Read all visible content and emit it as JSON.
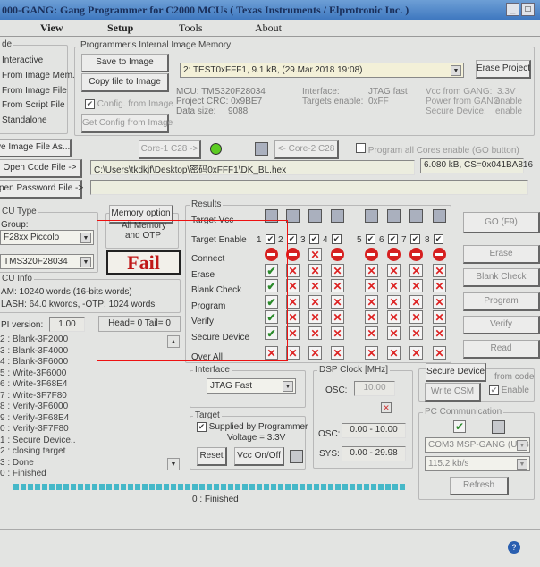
{
  "title": "000-GANG:  Gang Programmer for C2000  MCUs ( Texas Instruments / Elprotronic Inc. )",
  "menu": [
    "View",
    "Setup",
    "Tools",
    "About"
  ],
  "mode": {
    "legend": "de",
    "items": [
      "Interactive",
      "From Image Mem.",
      "From Image File",
      "From Script File",
      "Standalone"
    ]
  },
  "image_memory": {
    "legend": "Programmer's Internal Image Memory",
    "save": "Save to Image",
    "copy": "Copy file to Image",
    "config_from_image": "Config. from Image",
    "get_config": "Get Config from Image",
    "selected": "2: TEST0xFFF1,  9.1 kB,  (29.Mar.2018  19:08)",
    "erase_project": "Erase Project",
    "info": {
      "mcu": "MCU:  TMS320F28034",
      "crc": "Project CRC: 0x9BE7",
      "data_size_label": "Data size:",
      "data_size": "9088",
      "interface_label": "Interface:",
      "interface": "JTAG fast",
      "targets_label": "Targets enable:",
      "targets": "0xFF",
      "vcc_label": "Vcc from GANG:",
      "vcc": "3.3V",
      "power_label": "Power from GANG:",
      "power": "enable",
      "secure_label": "Secure Device:",
      "secure": "enable"
    }
  },
  "save_image_file": "ve Image File As...",
  "core1": "Core-1 C28 ->",
  "core2": "<- Core-2 C28",
  "program_all_cores": "Program all Cores enable (GO button)",
  "open_code": "Open Code File ->",
  "code_path": "C:\\Users\\tkdkjf\\Desktop\\密码0xFFF1\\DK_BL.hex",
  "code_info": "6.080 kB, CS=0x041BA816",
  "open_password": "pen Password File ->",
  "mcu_type": {
    "legend": "CU Type",
    "group_label": "Group:",
    "group": "F28xx Piccolo",
    "device": "TMS320F28034"
  },
  "memory_option": {
    "button": "Memory option",
    "value1": "All Memory",
    "value2": "and OTP"
  },
  "fail": "Fail",
  "mcu_info": {
    "legend": "CU Info",
    "ram": "AM: 10240 words (16-bits words)",
    "flash": "LASH:  64.0 kwords,  -OTP: 1024 words"
  },
  "api_label": "PI version:",
  "api_version": "1.00",
  "head_tail": "Head= 0  Tail= 0",
  "log": [
    "2 : Blank-3F2000",
    "3 : Blank-3F4000",
    "4 : Blank-3F6000",
    "5 : Write-3F6000",
    "6 : Write-3F68E4",
    "7 : Write-3F7F80",
    "8 : Verify-3F6000",
    "9 : Verify-3F68E4",
    "0 : Verify-3F7F80",
    "1 : Secure Device..",
    "2 : closing target",
    "3 : Done",
    "0 : Finished"
  ],
  "results": {
    "legend": "Results",
    "rows": [
      "Target Vcc",
      "Target Enable",
      "Connect",
      "Erase",
      "Blank Check",
      "Program",
      "Verify",
      "Secure Device",
      "Over All"
    ],
    "targets": [
      "1",
      "2",
      "3",
      "4",
      "5",
      "6",
      "7",
      "8"
    ],
    "status": [
      [
        "stop",
        "ok",
        "ok",
        "ok",
        "ok",
        "ok",
        "x"
      ],
      [
        "stop",
        "x",
        "x",
        "x",
        "x",
        "x",
        "x"
      ],
      [
        "x",
        "x",
        "x",
        "x",
        "x",
        "x",
        "x"
      ],
      [
        "stop",
        "x",
        "x",
        "x",
        "x",
        "x",
        "x"
      ],
      [
        "stop",
        "x",
        "x",
        "x",
        "x",
        "x",
        "x"
      ],
      [
        "stop",
        "x",
        "x",
        "x",
        "x",
        "x",
        "x"
      ],
      [
        "stop",
        "x",
        "x",
        "x",
        "x",
        "x",
        "x"
      ],
      [
        "stop",
        "x",
        "x",
        "x",
        "x",
        "x",
        "x"
      ]
    ]
  },
  "actions": [
    "GO  (F9)",
    "Erase",
    "Blank Check",
    "Program",
    "Verify",
    "Read"
  ],
  "interface": {
    "legend": "Interface",
    "value": "JTAG Fast"
  },
  "target": {
    "legend": "Target",
    "supplied": "Supplied by Programmer",
    "voltage": "Voltage = 3.3V",
    "reset": "Reset",
    "vcc_onoff": "Vcc On/Off"
  },
  "dsp_clock": {
    "legend": "DSP Clock [MHz]",
    "osc_label": "OSC:",
    "osc": "10.00",
    "osc_range_label": "OSC:",
    "osc_range": "0.00 - 10.00",
    "sys_label": "SYS:",
    "sys_range": "0.00 - 29.98"
  },
  "secure": {
    "button": "Secure Device",
    "from_code": "from code",
    "write_csm": "Write CSM",
    "enable": "Enable"
  },
  "pc_comm": {
    "legend": "PC Communication",
    "port": "COM3   MSP-GANG (USB",
    "baud": "115.2 kb/s",
    "refresh": "Refresh"
  },
  "progress_percent": 100,
  "status_text": "0 : Finished"
}
